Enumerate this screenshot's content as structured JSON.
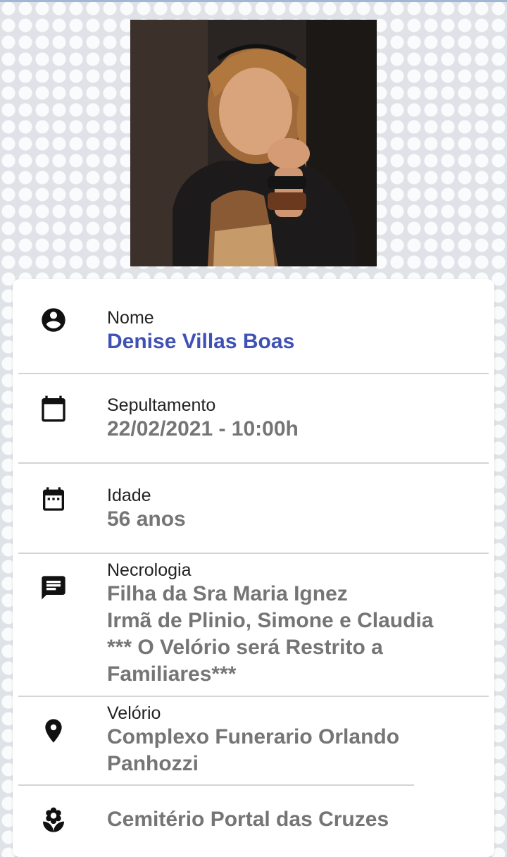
{
  "photo": {
    "alt": "Denise Villas Boas"
  },
  "fields": {
    "nome": {
      "label": "Nome",
      "value": "Denise Villas Boas",
      "icon": "account-circle-icon"
    },
    "sepultamento": {
      "label": "Sepultamento",
      "value": "22/02/2021 - 10:00h",
      "icon": "calendar-icon"
    },
    "idade": {
      "label": "Idade",
      "value": "56 anos",
      "icon": "calendar-dots-icon"
    },
    "necrologia": {
      "label": "Necrologia",
      "value": "Filha da Sra Maria Ignez\nIrmã de Plinio, Simone e Claudia\n*** O Velório será Restrito a Familiares***",
      "icon": "message-icon"
    },
    "velorio": {
      "label": "Velório",
      "value": "Complexo Funerario Orlando Panhozzi",
      "icon": "location-pin-icon"
    },
    "cemiterio": {
      "value": "Cemitério Portal das Cruzes",
      "icon": "flower-icon"
    }
  },
  "colors": {
    "name": "#3f51b5",
    "value": "#757575",
    "label": "#222222",
    "icon": "#111111"
  }
}
